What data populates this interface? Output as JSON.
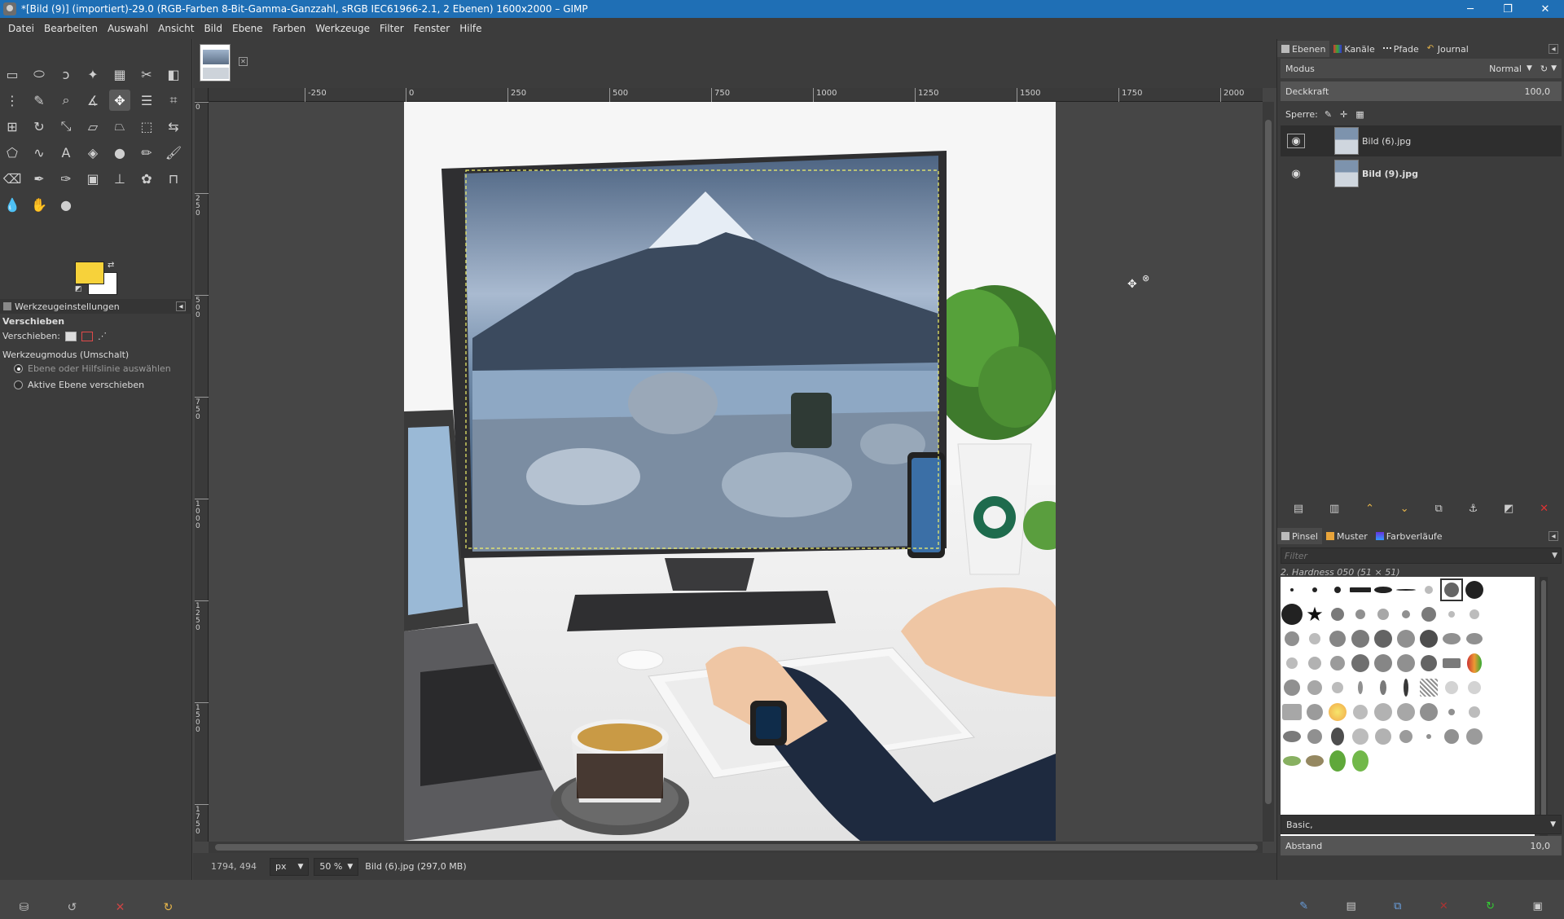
{
  "window": {
    "title": "*[Bild (9)] (importiert)-29.0 (RGB-Farben 8-Bit-Gamma-Ganzzahl, sRGB IEC61966-2.1, 2 Ebenen) 1600x2000 – GIMP",
    "minimize": "─",
    "maximize": "❐",
    "close": "✕"
  },
  "menu": [
    "Datei",
    "Bearbeiten",
    "Auswahl",
    "Ansicht",
    "Bild",
    "Ebene",
    "Farben",
    "Werkzeuge",
    "Filter",
    "Fenster",
    "Hilfe"
  ],
  "tool_options": {
    "tab_label": "Werkzeugeinstellungen",
    "tool_name": "Verschieben",
    "move_label": "Verschieben:",
    "mode_label": "Werkzeugmodus (Umschalt)",
    "option_1": "Ebene oder Hilfslinie auswählen",
    "option_2": "Aktive Ebene verschieben"
  },
  "colors": {
    "foreground": "#f7d23a",
    "background": "#ffffff",
    "titlebar": "#1f6fb5"
  },
  "rulers": {
    "horizontal": [
      "-250",
      "0",
      "250",
      "500",
      "750",
      "1000",
      "1250",
      "1500",
      "1750",
      "2000"
    ],
    "vertical": [
      "0",
      "250",
      "500",
      "750",
      "1000",
      "1250",
      "1500",
      "1750"
    ]
  },
  "status": {
    "coords": "1794, 494",
    "unit": "px",
    "zoom": "50 %",
    "layer_info": "Bild (6).jpg (297,0 MB)"
  },
  "layers_panel": {
    "tabs": [
      "Ebenen",
      "Kanäle",
      "Pfade",
      "Journal"
    ],
    "mode_label": "Modus",
    "mode_value": "Normal",
    "opacity_label": "Deckkraft",
    "opacity_value": "100,0",
    "lock_label": "Sperre:",
    "layers": [
      {
        "name": "Bild (6).jpg"
      },
      {
        "name": "Bild (9).jpg"
      }
    ]
  },
  "brushes_panel": {
    "tabs": [
      "Pinsel",
      "Muster",
      "Farbverläufe"
    ],
    "filter_placeholder": "Filter",
    "current_brush": "2. Hardness 050 (51 × 51)",
    "preset": "Basic,",
    "spacing_label": "Abstand",
    "spacing_value": "10,0"
  }
}
